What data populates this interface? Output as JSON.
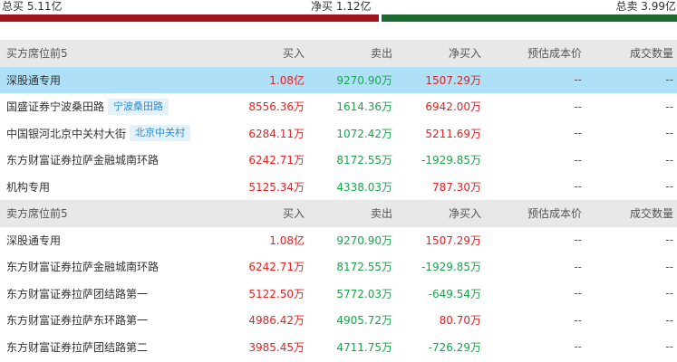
{
  "summary": {
    "total_buy": "总买 5.11亿",
    "net_buy": "净买 1.12亿",
    "total_sell": "总卖 3.99亿"
  },
  "colors": {
    "buy": "#e32222",
    "sell": "#17a64a",
    "bar_red": "#a0141c",
    "bar_green": "#1f6a33",
    "highlight": "#aee0f8"
  },
  "columns": {
    "buy": "买入",
    "sell": "卖出",
    "net": "净买入",
    "cost": "预估成本价",
    "qty": "成交数量"
  },
  "buy_section": {
    "title": "买方席位前5",
    "rows": [
      {
        "name": "深股通专用",
        "tag": "",
        "buy": "1.08亿",
        "sell": "9270.90万",
        "net": "1507.29万",
        "cost": "--",
        "qty": "--"
      },
      {
        "name": "国盛证券宁波桑田路",
        "tag": "宁波桑田路",
        "buy": "8556.36万",
        "sell": "1614.36万",
        "net": "6942.00万",
        "cost": "--",
        "qty": "--"
      },
      {
        "name": "中国银河北京中关村大街",
        "tag": "北京中关村",
        "buy": "6284.11万",
        "sell": "1072.42万",
        "net": "5211.69万",
        "cost": "--",
        "qty": "--"
      },
      {
        "name": "东方财富证券拉萨金融城南环路",
        "tag": "",
        "buy": "6242.71万",
        "sell": "8172.55万",
        "net": "-1929.85万",
        "cost": "--",
        "qty": "--"
      },
      {
        "name": "机构专用",
        "tag": "",
        "buy": "5125.34万",
        "sell": "4338.03万",
        "net": "787.30万",
        "cost": "--",
        "qty": "--"
      }
    ]
  },
  "sell_section": {
    "title": "卖方席位前5",
    "rows": [
      {
        "name": "深股通专用",
        "tag": "",
        "buy": "1.08亿",
        "sell": "9270.90万",
        "net": "1507.29万",
        "cost": "--",
        "qty": "--"
      },
      {
        "name": "东方财富证券拉萨金融城南环路",
        "tag": "",
        "buy": "6242.71万",
        "sell": "8172.55万",
        "net": "-1929.85万",
        "cost": "--",
        "qty": "--"
      },
      {
        "name": "东方财富证券拉萨团结路第一",
        "tag": "",
        "buy": "5122.50万",
        "sell": "5772.03万",
        "net": "-649.54万",
        "cost": "--",
        "qty": "--"
      },
      {
        "name": "东方财富证券拉萨东环路第一",
        "tag": "",
        "buy": "4986.42万",
        "sell": "4905.72万",
        "net": "80.70万",
        "cost": "--",
        "qty": "--"
      },
      {
        "name": "东方财富证券拉萨团结路第二",
        "tag": "",
        "buy": "3985.45万",
        "sell": "4711.75万",
        "net": "-726.29万",
        "cost": "--",
        "qty": "--"
      }
    ]
  }
}
